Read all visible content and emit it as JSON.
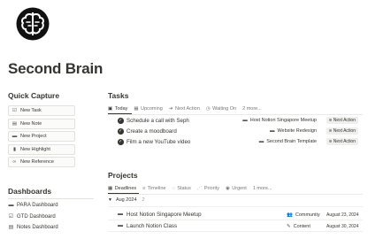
{
  "page": {
    "icon": "brain-icon",
    "title": "Second Brain"
  },
  "quick_capture": {
    "heading": "Quick Capture",
    "buttons": [
      {
        "label": "New Task",
        "icon": "task-icon"
      },
      {
        "label": "New Note",
        "icon": "note-icon"
      },
      {
        "label": "New Project",
        "icon": "folder-icon"
      },
      {
        "label": "New Highlight",
        "icon": "bookmark-icon"
      },
      {
        "label": "New Reference",
        "icon": "link-icon"
      }
    ]
  },
  "tasks": {
    "heading": "Tasks",
    "tabs": [
      {
        "label": "Today",
        "icon": "calendar-icon",
        "active": true
      },
      {
        "label": "Upcoming",
        "icon": "calendar-icon",
        "active": false
      },
      {
        "label": "Next Action",
        "icon": "arrow-icon",
        "active": false
      },
      {
        "label": "Waiting On",
        "icon": "clock-icon",
        "active": false
      }
    ],
    "more_label": "2 more...",
    "rows": [
      {
        "title": "Schedule a call with Seph",
        "project": "Host Notion Singapore Meetup",
        "status": "Next Action"
      },
      {
        "title": "Create a moodboard",
        "project": "Website Redesign",
        "status": "Next Action"
      },
      {
        "title": "Film a new YouTube video",
        "project": "Second Brain Template",
        "status": "Next Action"
      }
    ]
  },
  "projects": {
    "heading": "Projects",
    "tabs": [
      {
        "label": "Deadlines",
        "icon": "calendar-icon",
        "active": true
      },
      {
        "label": "Timeline",
        "icon": "timeline-icon",
        "active": false
      },
      {
        "label": "Status",
        "icon": "status-icon",
        "active": false
      },
      {
        "label": "Priority",
        "icon": "priority-icon",
        "active": false
      },
      {
        "label": "Urgent",
        "icon": "urgent-icon",
        "active": false
      }
    ],
    "more_label": "1 more...",
    "group": {
      "label": "Aug 2024",
      "count": "2"
    },
    "rows": [
      {
        "title": "Host Notion Singapore Meetup",
        "area": "Community",
        "date": "August 23, 2024"
      },
      {
        "title": "Launch Notion Class",
        "area": "Content",
        "date": "August 30, 2024"
      }
    ]
  },
  "dashboards": {
    "heading": "Dashboards",
    "items": [
      {
        "label": "PARA Dashboard",
        "icon": "folder-icon"
      },
      {
        "label": "GTD Dashboard",
        "icon": "check-icon"
      },
      {
        "label": "Notes Dashboard",
        "icon": "note-icon"
      }
    ]
  }
}
